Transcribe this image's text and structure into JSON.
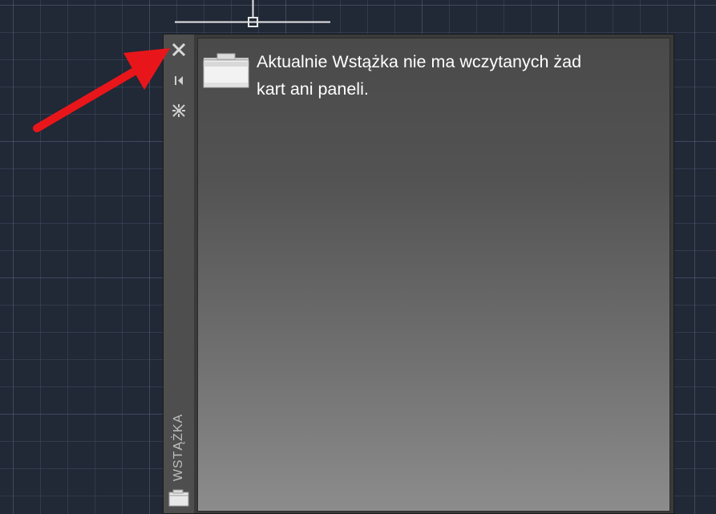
{
  "palette": {
    "title_vertical": "WSTĄŻKA",
    "buttons": {
      "close_icon": "close-icon",
      "autohide_icon": "auto-hide-icon",
      "properties_icon": "properties-icon"
    },
    "message_lines": [
      "Aktualnie Wstążka nie ma wczytanych żad",
      "kart ani paneli."
    ]
  },
  "colors": {
    "canvas_background": "#212836",
    "palette_titlebar": "#4e4e4e",
    "annotation_arrow": "#e8161a",
    "message_text": "#ffffff"
  }
}
